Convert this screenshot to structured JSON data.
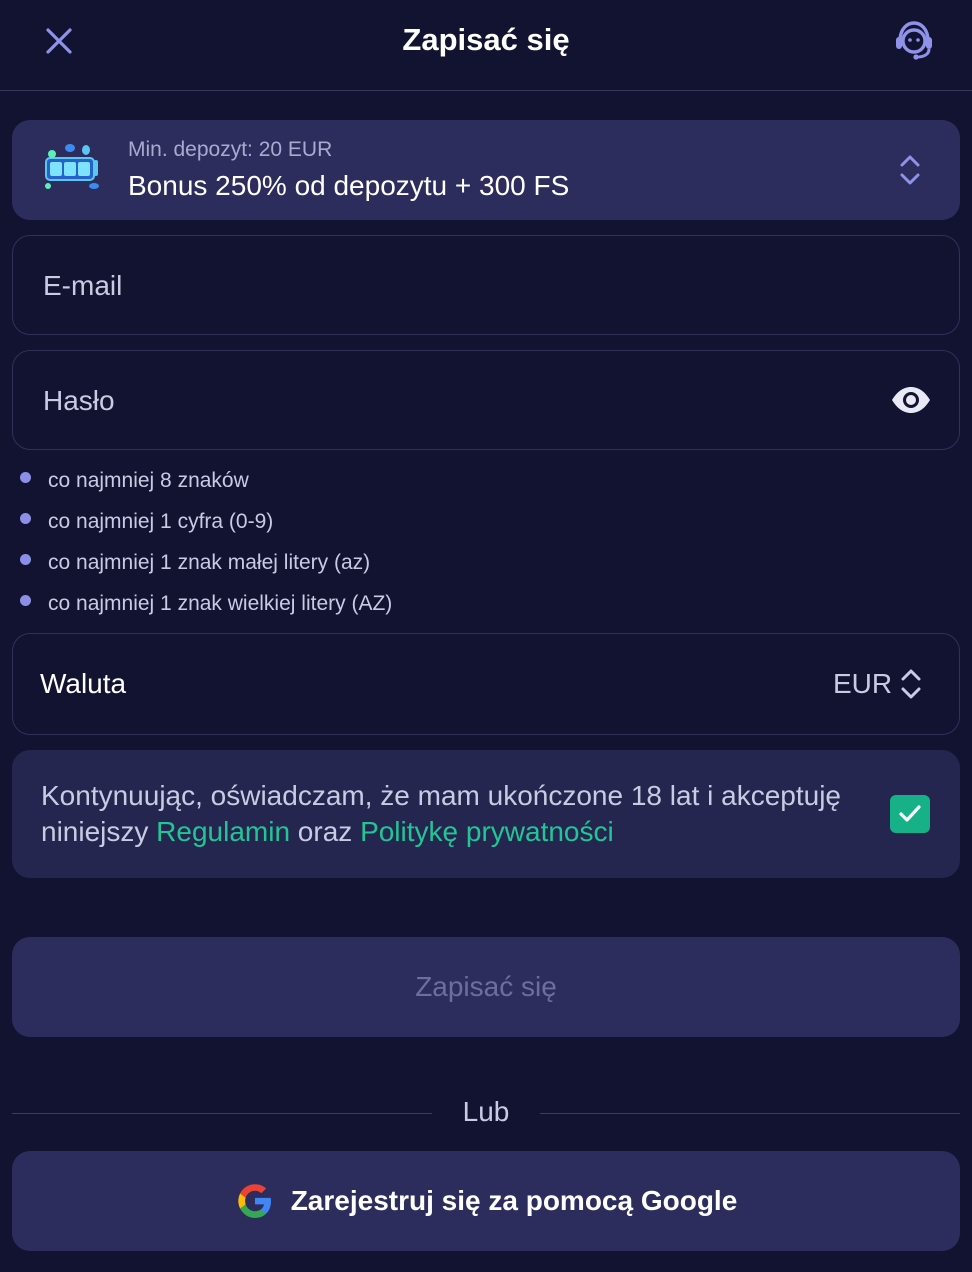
{
  "header": {
    "title": "Zapisać się",
    "close_icon": "close-icon",
    "support_icon": "headset-support-icon"
  },
  "bonus": {
    "min_deposit": "Min. depozyt: 20 EUR",
    "offer": "Bonus 250% od depozytu + 300 FS",
    "icon": "slot-machine-icon"
  },
  "form": {
    "email_placeholder": "E-mail",
    "password_placeholder": "Hasło",
    "password_rules": [
      "co najmniej 8 znaków",
      "co najmniej 1 cyfra (0-9)",
      "co najmniej 1 znak małej litery (az)",
      "co najmniej 1 znak wielkiej litery (AZ)"
    ],
    "currency_label": "Waluta",
    "currency_value": "EUR"
  },
  "consent": {
    "text_before": "Kontynuując, oświadczam, że mam ukończone 18 lat i akceptuję niniejszy ",
    "terms_link": "Regulamin",
    "text_between": " oraz ",
    "privacy_link": "Politykę prywatności",
    "checked": true
  },
  "actions": {
    "submit_label": "Zapisać się",
    "divider_label": "Lub",
    "google_label": "Zarejestruj się za pomocą Google"
  },
  "colors": {
    "background": "#121331",
    "card": "#2c2d5c",
    "accent_green": "#22c594",
    "checkbox": "#17b187",
    "muted_text": "#c9cbe3"
  }
}
